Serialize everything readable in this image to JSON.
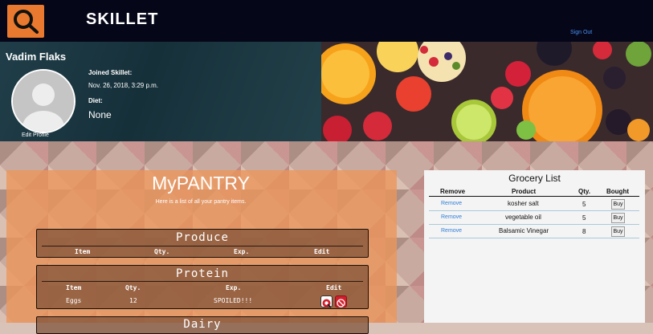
{
  "nav": {
    "brand": "SKILLET",
    "sign_out": "Sign Out"
  },
  "profile": {
    "name": "Vadim Flaks",
    "edit_profile": "Edit Profile",
    "joined_label": "Joined Skillet:",
    "joined_value": "Nov. 26, 2018, 3:29 p.m.",
    "diet_label": "Diet:",
    "diet_value": "None"
  },
  "pantry": {
    "title": "MyPANTRY",
    "subtitle": "Here is a list of all your pantry items.",
    "categories": [
      {
        "title": "Produce",
        "columns": [
          "Item",
          "Qty.",
          "Exp.",
          "Edit"
        ],
        "rows": []
      },
      {
        "title": "Protein",
        "columns": [
          "Item",
          "Qty.",
          "Exp.",
          "Edit"
        ],
        "rows": [
          {
            "item": "Eggs",
            "qty": "12",
            "exp": "SPOILED!!!"
          }
        ]
      },
      {
        "title": "Dairy",
        "columns": [],
        "rows": []
      }
    ]
  },
  "grocery": {
    "title": "Grocery List",
    "columns": [
      "Remove",
      "Product",
      "Qty.",
      "Bought"
    ],
    "rows": [
      {
        "remove": "Remove",
        "product": "kosher salt",
        "qty": "5",
        "buy": "Buy"
      },
      {
        "remove": "Remove",
        "product": "vegetable oil",
        "qty": "5",
        "buy": "Buy"
      },
      {
        "remove": "Remove",
        "product": "Balsamic Vinegar",
        "qty": "8",
        "buy": "Buy"
      }
    ]
  },
  "colors": {
    "nav_bg": "#050719",
    "logo_bg": "#e9792f",
    "link": "#2f7fd8",
    "pantry_overlay": "#ec965a"
  },
  "icons": [
    "skillet-logo-icon",
    "avatar-placeholder-icon",
    "edit-item-icon",
    "delete-item-icon"
  ]
}
